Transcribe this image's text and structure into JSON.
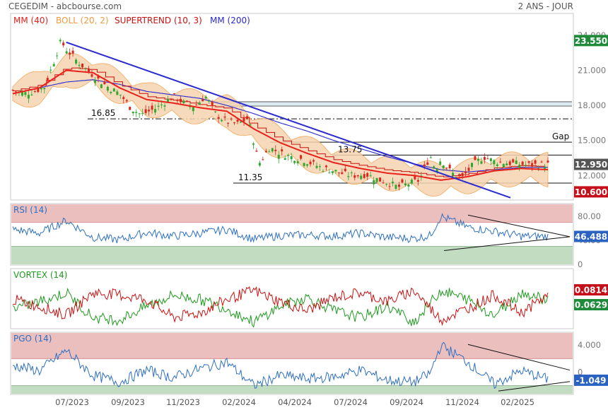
{
  "header": {
    "source": "CEGEDIM - abcbourse.com",
    "period": "2 ANS - JOUR"
  },
  "colors": {
    "ma40": "#e8211c",
    "boll": "#f29a3e",
    "supertrend": "#cc1111",
    "ma200": "#2a2ad0",
    "price": "#1a1a1a",
    "up": "#2fa82f",
    "down": "#d8281c",
    "rsi": "#2e6fc2",
    "vortex_plus": "#1e9a1e",
    "vortex_minus": "#cc1111",
    "badge_green": "#1f8a3a",
    "badge_gray": "#555555",
    "badge_red": "#c4101a",
    "badge_blue": "#2a62c2",
    "zone_high": "#ecbfbf",
    "zone_low": "#c2dcc2"
  },
  "x_axis_labels": [
    "07/2023",
    "09/2023",
    "11/2023",
    "02/2024",
    "04/2024",
    "07/2024",
    "09/2024",
    "11/2024",
    "02/2025"
  ],
  "chart_data": [
    {
      "type": "line",
      "panel": "price",
      "legend": [
        "MM (40)",
        "BOLL (20, 2)",
        "SUPERTREND (10, 3)",
        "MM (200)"
      ],
      "y_ticks": [
        "24.000",
        "21.000",
        "18.000",
        "15.000",
        "12.000"
      ],
      "ylim": [
        10.2,
        24.6
      ],
      "annotations": [
        {
          "text": "16.85",
          "y": 16.85
        },
        {
          "text": "13.75",
          "y": 13.75
        },
        {
          "text": "11.35",
          "y": 11.35
        },
        {
          "text": "Gap",
          "y": 14.85
        }
      ],
      "badges": [
        {
          "text": "23.550",
          "y": 23.55,
          "color": "badge_green"
        },
        {
          "text": "12.950",
          "y": 12.95,
          "color": "badge_gray"
        },
        {
          "text": "10.600",
          "y": 10.6,
          "color": "badge_red"
        }
      ],
      "horizontal_levels": [
        18.3,
        17.95,
        16.85,
        14.85,
        13.75,
        11.35
      ],
      "series": [
        {
          "name": "Cours",
          "x": [
            0,
            0.02,
            0.04,
            0.06,
            0.075,
            0.09,
            0.1,
            0.12,
            0.14,
            0.16,
            0.18,
            0.2,
            0.22,
            0.24,
            0.27,
            0.3,
            0.32,
            0.34,
            0.36,
            0.38,
            0.4,
            0.42,
            0.44,
            0.46,
            0.48,
            0.5,
            0.52,
            0.54,
            0.56,
            0.58,
            0.6,
            0.62,
            0.64,
            0.66,
            0.68,
            0.7,
            0.72,
            0.74,
            0.76,
            0.78,
            0.79,
            0.8,
            0.82,
            0.84,
            0.86,
            0.88,
            0.9,
            0.92,
            0.94,
            0.96,
            0.98,
            1.0
          ],
          "values": [
            19.3,
            19.0,
            19.2,
            19.6,
            21.5,
            23.5,
            22.8,
            21.8,
            21.0,
            20.2,
            19.5,
            19.0,
            17.8,
            17.2,
            17.8,
            18.8,
            18.2,
            17.9,
            18.8,
            17.2,
            16.6,
            16.4,
            16.9,
            13.0,
            14.4,
            13.9,
            13.6,
            13.4,
            13.0,
            12.6,
            12.4,
            12.1,
            12.0,
            12.1,
            11.7,
            11.4,
            11.0,
            11.3,
            11.6,
            13.7,
            12.5,
            13.4,
            12.2,
            11.8,
            12.9,
            13.6,
            13.2,
            13.1,
            13.0,
            12.9,
            12.9,
            12.95
          ]
        },
        {
          "name": "MM (40)",
          "x": [
            0,
            0.05,
            0.1,
            0.15,
            0.2,
            0.25,
            0.3,
            0.35,
            0.4,
            0.45,
            0.5,
            0.55,
            0.6,
            0.65,
            0.7,
            0.75,
            0.8,
            0.85,
            0.9,
            0.95,
            1.0
          ],
          "values": [
            19.0,
            19.5,
            21.0,
            20.8,
            19.5,
            18.5,
            18.2,
            17.8,
            17.5,
            16.0,
            14.8,
            13.9,
            13.1,
            12.6,
            12.2,
            12.0,
            11.6,
            11.9,
            12.4,
            12.6,
            12.5
          ]
        },
        {
          "name": "MM (200)",
          "x": [
            0,
            0.05,
            0.1,
            0.15,
            0.2,
            0.25,
            0.3,
            0.35,
            0.4,
            0.45,
            0.5,
            0.55,
            0.6,
            0.65,
            0.7,
            0.75,
            0.8,
            0.85,
            0.9,
            0.95,
            1.0
          ],
          "values": [
            19.0,
            19.5,
            20.0,
            20.2,
            19.8,
            19.2,
            18.9,
            18.6,
            18.0,
            17.3,
            16.5,
            15.8,
            15.0,
            14.3,
            13.6,
            13.0,
            12.5,
            12.3,
            12.5,
            12.7,
            12.7
          ]
        },
        {
          "name": "Trendline",
          "x": [
            0,
            1
          ],
          "values": [
            23.5,
            10.7
          ]
        }
      ]
    },
    {
      "type": "line",
      "panel": "rsi",
      "legend": [
        "RSI (14)"
      ],
      "y_ticks": [
        "80.00",
        "40.00",
        "0"
      ],
      "ylim": [
        0,
        100
      ],
      "zones": {
        "high": [
          70,
          100
        ],
        "low": [
          0,
          30
        ]
      },
      "badge": {
        "text": "46.488",
        "value": 46.488,
        "color": "badge_blue"
      },
      "series": [
        {
          "name": "RSI (14)",
          "x": [
            0,
            0.05,
            0.1,
            0.15,
            0.2,
            0.25,
            0.3,
            0.35,
            0.4,
            0.45,
            0.5,
            0.55,
            0.6,
            0.65,
            0.7,
            0.75,
            0.78,
            0.8,
            0.85,
            0.9,
            0.95,
            1.0
          ],
          "values": [
            58,
            52,
            73,
            45,
            41,
            53,
            47,
            52,
            58,
            42,
            48,
            49,
            47,
            52,
            45,
            43,
            48,
            80,
            62,
            55,
            47,
            46.5
          ]
        }
      ]
    },
    {
      "type": "line",
      "panel": "vortex",
      "legend": [
        "VORTEX (14)"
      ],
      "badges": [
        {
          "text": "0.0814",
          "value": 0.0814,
          "color": "badge_red"
        },
        {
          "text": "0.0629",
          "value": 0.0629,
          "color": "badge_green"
        }
      ],
      "series": [
        {
          "name": "VI+",
          "x": [
            0,
            0.05,
            0.1,
            0.15,
            0.2,
            0.25,
            0.3,
            0.35,
            0.4,
            0.45,
            0.5,
            0.55,
            0.6,
            0.65,
            0.7,
            0.75,
            0.8,
            0.85,
            0.9,
            0.95,
            1.0
          ],
          "values": [
            0.02,
            0.05,
            0.09,
            -0.02,
            -0.03,
            0.03,
            0.08,
            0.06,
            0.02,
            -0.04,
            0.03,
            0.07,
            0.01,
            -0.02,
            0.03,
            -0.04,
            0.1,
            0.06,
            -0.01,
            0.09,
            0.06
          ]
        },
        {
          "name": "VI-",
          "x": [
            0,
            0.05,
            0.1,
            0.15,
            0.2,
            0.25,
            0.3,
            0.35,
            0.4,
            0.45,
            0.5,
            0.55,
            0.6,
            0.65,
            0.7,
            0.75,
            0.8,
            0.85,
            0.9,
            0.95,
            1.0
          ],
          "values": [
            0.06,
            0.03,
            -0.01,
            0.09,
            0.08,
            0.06,
            -0.02,
            0.0,
            0.06,
            0.1,
            0.05,
            0.01,
            0.07,
            0.09,
            0.05,
            0.1,
            -0.03,
            0.02,
            0.08,
            0.0,
            0.08
          ]
        }
      ]
    },
    {
      "type": "line",
      "panel": "pgo",
      "legend": [
        "PGO (14)"
      ],
      "y_ticks": [
        "4.000",
        "0"
      ],
      "ylim": [
        -3.2,
        5.8
      ],
      "zones": {
        "high": [
          2,
          5.8
        ],
        "low": [
          -3.2,
          -2
        ]
      },
      "badge": {
        "text": "-1.049",
        "value": -1.049,
        "color": "badge_blue"
      },
      "series": [
        {
          "name": "PGO (14)",
          "x": [
            0,
            0.05,
            0.1,
            0.15,
            0.2,
            0.25,
            0.3,
            0.35,
            0.4,
            0.45,
            0.5,
            0.55,
            0.6,
            0.65,
            0.7,
            0.75,
            0.78,
            0.8,
            0.85,
            0.9,
            0.95,
            1.0
          ],
          "values": [
            1.0,
            0.2,
            3.2,
            -0.5,
            -1.5,
            0.3,
            -0.8,
            0.5,
            1.5,
            -2.0,
            -0.5,
            -1.0,
            -0.7,
            0.3,
            -1.2,
            -1.5,
            -0.2,
            4.0,
            1.5,
            -1.8,
            0.2,
            -1.05
          ]
        }
      ]
    }
  ]
}
